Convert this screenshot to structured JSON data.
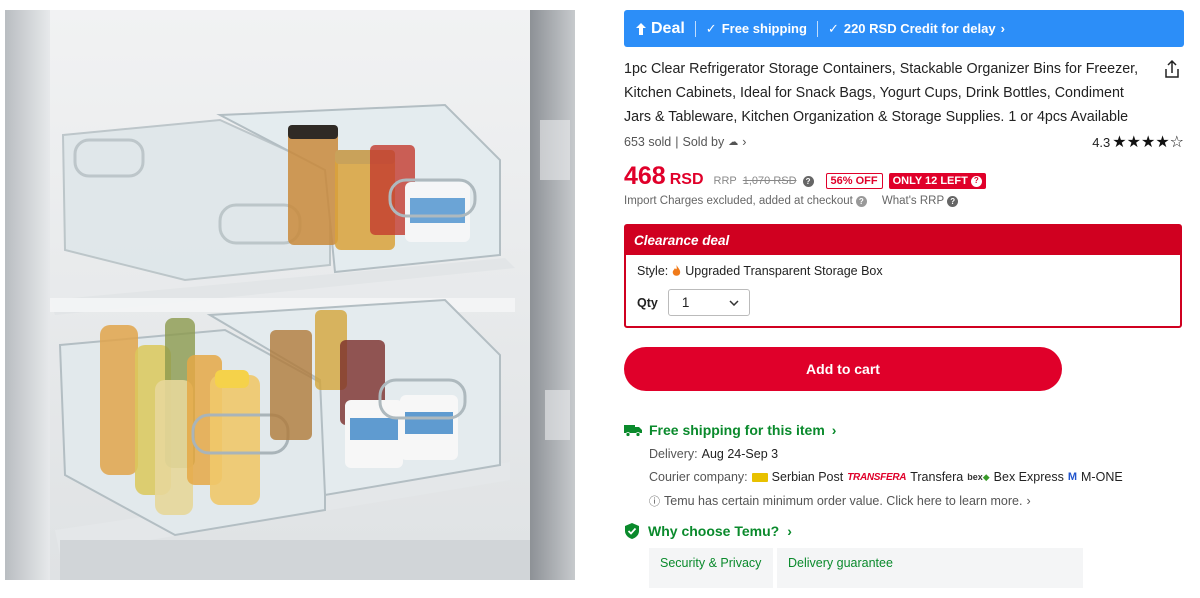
{
  "deal_bar": {
    "deal_label": "Deal",
    "free_shipping": "Free shipping",
    "credit": "220 RSD Credit for delay"
  },
  "product": {
    "title": "1pc Clear Refrigerator Storage Containers, Stackable Organizer Bins for Freezer, Kitchen Cabinets, Ideal for Snack Bags, Yogurt Cups, Drink Bottles, Condiment Jars & Tableware, Kitchen Organization & Storage Supplies. 1 or 4pcs Available",
    "sold": "653 sold",
    "sold_by": "Sold by",
    "rating": "4.3",
    "stars_full": 4,
    "stars_total": 5
  },
  "price": {
    "value": "468",
    "currency": "RSD",
    "rrp_label": "RRP",
    "rrp_value": "1,070 RSD",
    "discount": "56% OFF",
    "stock": "ONLY 12 LEFT",
    "import_note": "Import Charges excluded, added at checkout",
    "whats_rrp": "What's RRP"
  },
  "clearance": {
    "heading": "Clearance deal",
    "style_label": "Style:",
    "style_value": "Upgraded Transparent Storage Box",
    "qty_label": "Qty",
    "qty_value": "1"
  },
  "cart": {
    "add_label": "Add to cart"
  },
  "shipping": {
    "heading": "Free shipping for this item",
    "delivery_label": "Delivery:",
    "delivery_value": "Aug 24-Sep 3",
    "courier_label": "Courier company:",
    "couriers": [
      "Serbian Post",
      "Transfera",
      "Bex Express",
      "M-ONE"
    ],
    "transfera_logo": "TRANSFERA",
    "bex_logo": "bex",
    "mone_logo": "M",
    "min_order_note": "Temu has certain minimum order value. Click here to learn more."
  },
  "why": {
    "heading": "Why choose Temu?",
    "cards": [
      "Security & Privacy",
      "Delivery guarantee"
    ]
  },
  "colors": {
    "deal_blue": "#2c8ef8",
    "price_red": "#e0002a",
    "green": "#0a8a2c"
  }
}
